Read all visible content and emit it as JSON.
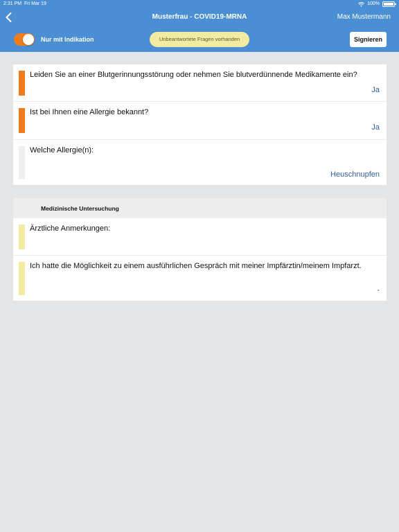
{
  "statusbar": {
    "time": "2:31 PM",
    "date": "Fri Mar 19",
    "battery": "100%"
  },
  "header": {
    "title": "Musterfrau - COVID19-MRNA",
    "user": "Max Mustermann",
    "toggle_label": "Nur mit Indikation",
    "toggle_on": true,
    "warning": "Unbeantwortete Fragen vorhanden",
    "sign_label": "Signieren"
  },
  "colors": {
    "header": "#4a8fd3",
    "accent_orange": "#f07d1d",
    "bar_gray": "#efefef",
    "bar_yellow": "#f3eba1",
    "answer_blue": "#2f5d9b"
  },
  "questions": [
    {
      "text": "Leiden Sie an einer Blutgerinnungsstörung oder nehmen Sie blutverdünnende Medikamente ein?",
      "answer": "Ja",
      "status": "orange"
    },
    {
      "text": "Ist bei Ihnen eine Allergie bekannt?",
      "answer": "Ja",
      "status": "orange"
    },
    {
      "text": "Welche Allergie(n):",
      "answer": "Heuschnupfen",
      "status": "gray"
    }
  ],
  "section": {
    "title": "Medizinische Untersuchung",
    "items": [
      {
        "text": "Ärztliche Anmerkungen:",
        "answer": "",
        "status": "yellow"
      },
      {
        "text": "Ich hatte die Möglichkeit zu einem ausführlichen Gespräch mit meiner Impfärztin/meinem Impfarzt.",
        "answer": "-",
        "status": "yellow"
      }
    ]
  }
}
